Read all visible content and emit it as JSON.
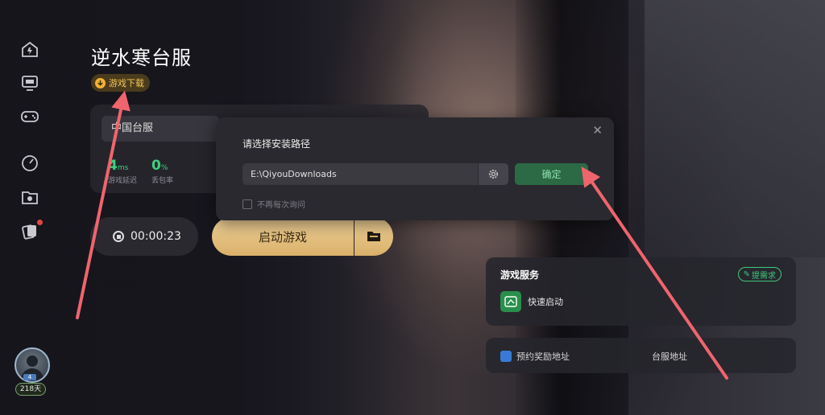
{
  "game": {
    "title": "逆水寒台服",
    "download_badge": "游戏下载"
  },
  "server": {
    "name": "中国台服",
    "latency_value": "4",
    "latency_unit": "ms",
    "latency_label": "游戏延迟",
    "loss_value": "0",
    "loss_unit": "%",
    "loss_label": "丢包率"
  },
  "session": {
    "timer": "00:00:23",
    "launch_label": "启动游戏"
  },
  "services": {
    "title": "游戏服务",
    "request_label": "提需求",
    "quick_start": "快速启动",
    "reserve_address": "预约奖励地址",
    "server_address": "台服地址"
  },
  "dialog": {
    "title": "请选择安装路径",
    "path_value": "E:\\QiyouDownloads",
    "confirm_label": "确定",
    "no_ask_label": "不再每次询问"
  },
  "user": {
    "level": "4",
    "days": "218天"
  },
  "colors": {
    "accent_green": "#3ed07e",
    "gold": "#d9b06a",
    "annotation": "#f0646e"
  }
}
